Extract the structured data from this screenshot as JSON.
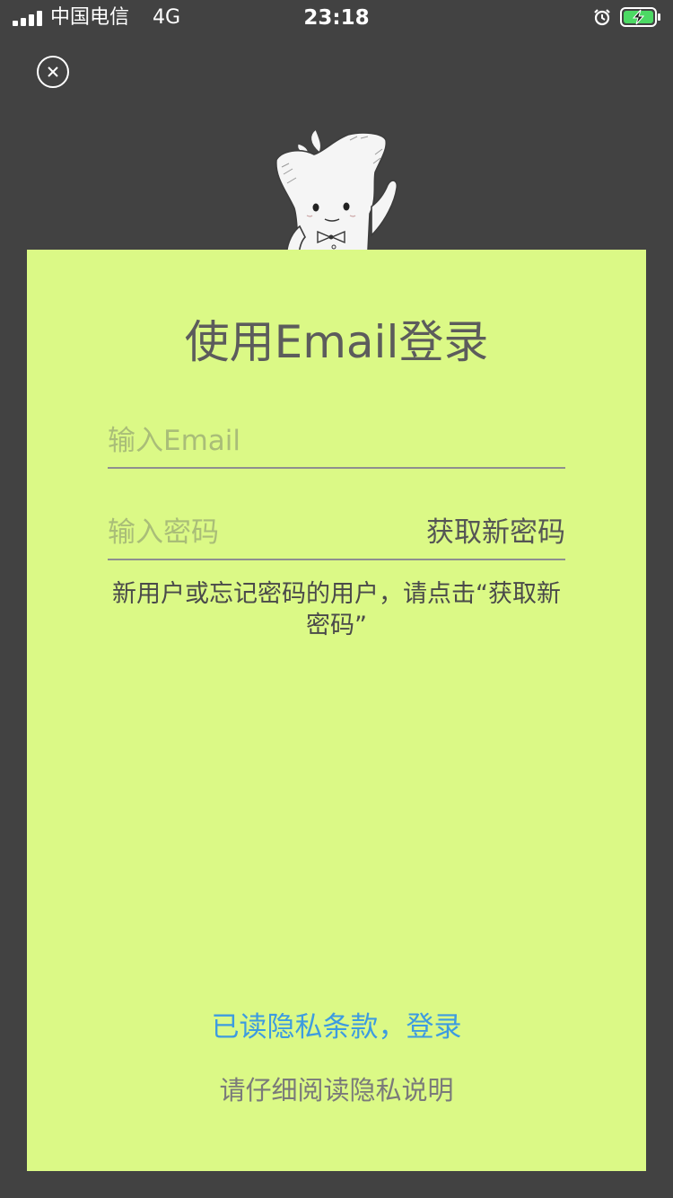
{
  "status_bar": {
    "carrier": "中国电信",
    "network": "4G",
    "time": "23:18",
    "alarm_icon": "alarm-clock-icon",
    "battery_icon": "battery-charging-icon",
    "battery_color": "#4cd964"
  },
  "close_icon": "close-icon",
  "login": {
    "title": "使用Email登录",
    "email_placeholder": "输入Email",
    "email_value": "",
    "password_placeholder": "输入密码",
    "password_value": "",
    "get_password_label": "获取新密码",
    "hint": "新用户或忘记密码的用户，请点击“获取新密码”",
    "submit_label": "已读隐私条款，登录",
    "privacy_label": "请仔细阅读隐私说明"
  },
  "colors": {
    "background": "#424242",
    "card": "#dbf986",
    "link": "#3d9be0"
  }
}
